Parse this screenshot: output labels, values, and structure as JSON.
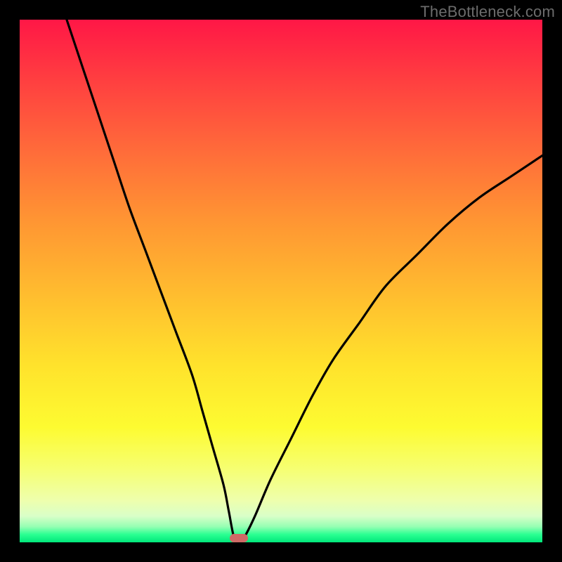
{
  "watermark": "TheBottleneck.com",
  "chart_data": {
    "type": "line",
    "title": "",
    "xlabel": "",
    "ylabel": "",
    "xlim": [
      0,
      100
    ],
    "ylim": [
      0,
      100
    ],
    "grid": false,
    "legend": false,
    "gradient_stops": [
      {
        "pos": 0,
        "color": "#ff1746"
      },
      {
        "pos": 12,
        "color": "#ff4040"
      },
      {
        "pos": 25,
        "color": "#ff6b3a"
      },
      {
        "pos": 38,
        "color": "#ff9433"
      },
      {
        "pos": 52,
        "color": "#ffbb2f"
      },
      {
        "pos": 66,
        "color": "#ffe22c"
      },
      {
        "pos": 78,
        "color": "#fdfb31"
      },
      {
        "pos": 86,
        "color": "#f6ff72"
      },
      {
        "pos": 92,
        "color": "#eeffad"
      },
      {
        "pos": 95,
        "color": "#d9ffc8"
      },
      {
        "pos": 97,
        "color": "#96ffb3"
      },
      {
        "pos": 98.5,
        "color": "#2bff92"
      },
      {
        "pos": 100,
        "color": "#00e77a"
      }
    ],
    "series": [
      {
        "name": "bottleneck-curve",
        "x": [
          9,
          12,
          15,
          18,
          21,
          24,
          27,
          30,
          33,
          35,
          37,
          39,
          40,
          41,
          42,
          43,
          45,
          48,
          52,
          56,
          60,
          65,
          70,
          76,
          82,
          88,
          94,
          100
        ],
        "y": [
          100,
          91,
          82,
          73,
          64,
          56,
          48,
          40,
          32,
          25,
          18,
          11,
          6,
          1,
          0,
          1,
          5,
          12,
          20,
          28,
          35,
          42,
          49,
          55,
          61,
          66,
          70,
          74
        ]
      }
    ],
    "minimum_marker": {
      "x": 42,
      "y": 0,
      "color": "#cf6a66"
    }
  }
}
